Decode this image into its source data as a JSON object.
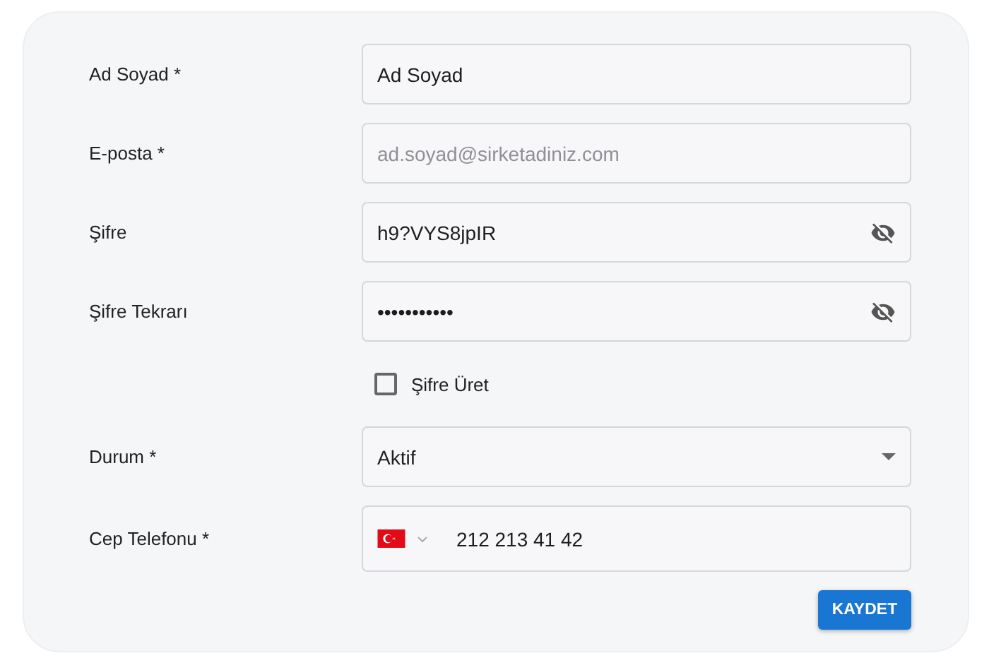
{
  "form": {
    "rows": [
      {
        "kind": "text",
        "label": "Ad Soyad *",
        "value": "Ad Soyad"
      },
      {
        "kind": "text",
        "label": "E-posta *",
        "placeholder": "ad.soyad@sirketadiniz.com"
      },
      {
        "kind": "password",
        "label": "Şifre",
        "value": "h9?VYS8jpIR"
      },
      {
        "kind": "password",
        "label": "Şifre Tekrarı",
        "value": "•••••••••••"
      },
      {
        "kind": "checkbox",
        "label": "Şifre Üret",
        "checked": false
      },
      {
        "kind": "select",
        "label": "Durum *",
        "value": "Aktif"
      },
      {
        "kind": "phone",
        "label": "Cep Telefonu *",
        "value": "212 213 41 42"
      }
    ],
    "submit": "KAYDET"
  }
}
